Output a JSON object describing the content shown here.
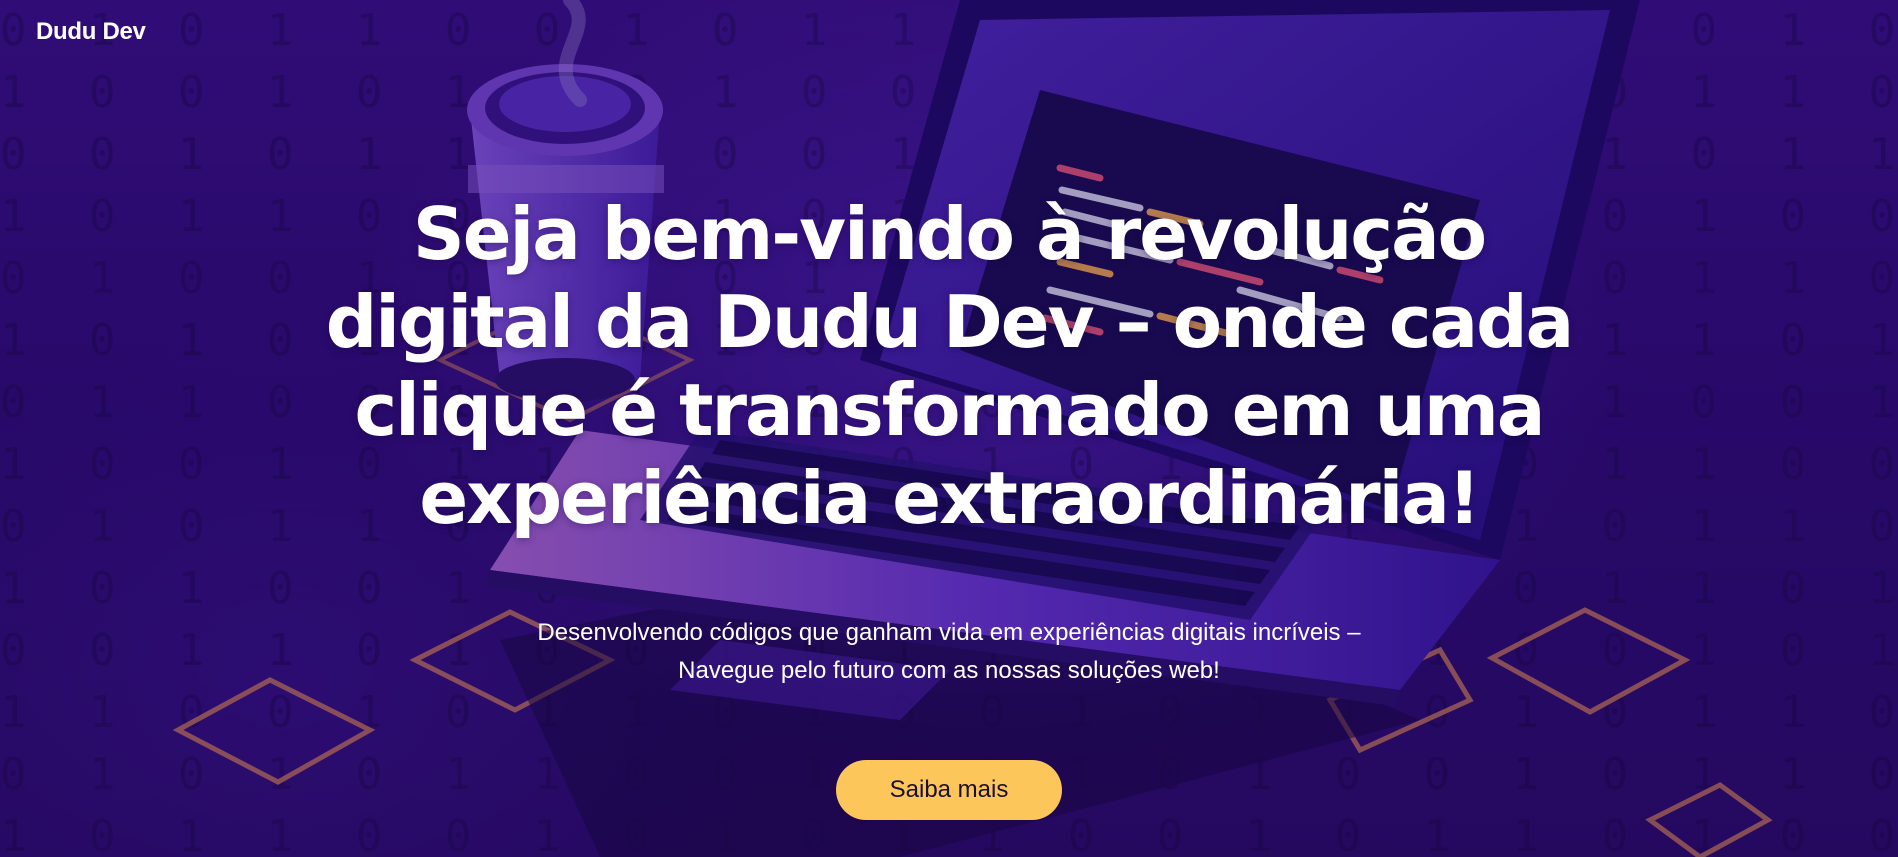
{
  "header": {
    "brand": "Dudu Dev"
  },
  "hero": {
    "title": "Seja bem-vindo à revolução digital da Dudu Dev – onde cada clique é transformado em uma experiência extraordinária!",
    "subtitle": "Desenvolvendo códigos que ganham vida em experiências digitais incríveis – Navegue pelo futuro com as nossas soluções web!",
    "cta_label": "Saiba mais"
  },
  "colors": {
    "background": "#2e0b78",
    "accent": "#fcc65a",
    "text": "#ffffff"
  }
}
